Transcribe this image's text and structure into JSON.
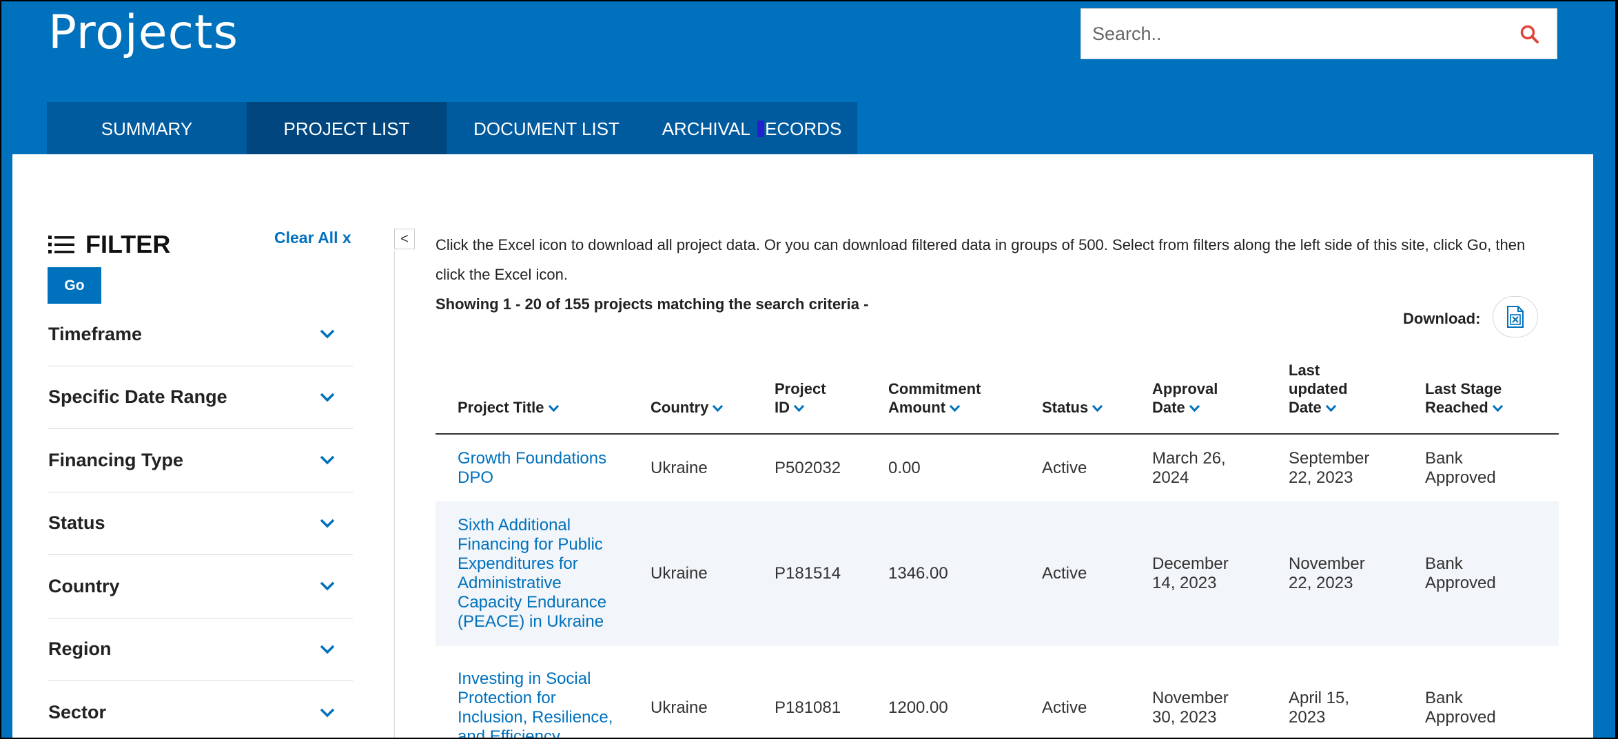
{
  "header": {
    "title": "Projects",
    "search_placeholder": "Search..",
    "search_icon": "search-icon",
    "accent_color": "#0071bc",
    "search_icon_color": "#e0453a"
  },
  "tabs": [
    {
      "label": "SUMMARY",
      "active": false
    },
    {
      "label": "PROJECT LIST",
      "active": true
    },
    {
      "label": "DOCUMENT LIST",
      "active": false
    },
    {
      "label_pre": "ARCHIVAL ",
      "label_post": "ECORDS",
      "active": false
    }
  ],
  "filter": {
    "title": "FILTER",
    "icon": "list-icon",
    "clear_all": "Clear All x",
    "go_label": "Go",
    "items": [
      "Timeframe",
      "Specific Date Range",
      "Financing Type",
      "Status",
      "Country",
      "Region",
      "Sector"
    ]
  },
  "collapse_label": "<",
  "main": {
    "info": "Click the Excel icon to download all project data. Or you can download filtered data in groups of 500. Select from filters along the left side of this site, click Go, then click the Excel icon.",
    "showing": "Showing 1 - 20 of 155 projects matching the search criteria -",
    "download_label": "Download:",
    "download_icon": "excel-icon"
  },
  "table": {
    "columns": [
      {
        "lines": [
          "Project Title"
        ]
      },
      {
        "lines": [
          "Country"
        ]
      },
      {
        "lines": [
          "Project",
          "ID"
        ]
      },
      {
        "lines": [
          "Commitment",
          "Amount"
        ]
      },
      {
        "lines": [
          "Status"
        ]
      },
      {
        "lines": [
          "Approval",
          "Date"
        ]
      },
      {
        "lines": [
          "Last",
          "updated",
          "Date"
        ]
      },
      {
        "lines": [
          "Last Stage",
          "Reached"
        ]
      }
    ],
    "rows": [
      {
        "title": [
          "Growth Foundations",
          "DPO"
        ],
        "country": "Ukraine",
        "id": "P502032",
        "amount": "0.00",
        "status": "Active",
        "approval": [
          "March 26,",
          "2024"
        ],
        "updated": [
          "September",
          "22, 2023"
        ],
        "stage": [
          "Bank",
          "Approved"
        ]
      },
      {
        "title": [
          "Sixth Additional",
          "Financing for Public",
          "Expenditures for",
          "Administrative",
          "Capacity Endurance",
          "(PEACE) in Ukraine"
        ],
        "country": "Ukraine",
        "id": "P181514",
        "amount": "1346.00",
        "status": "Active",
        "approval": [
          "December",
          "14, 2023"
        ],
        "updated": [
          "November",
          "22, 2023"
        ],
        "stage": [
          "Bank",
          "Approved"
        ]
      },
      {
        "title": [
          "Investing in Social",
          "Protection for",
          "Inclusion, Resilience,",
          "and Efficiency"
        ],
        "country": "Ukraine",
        "id": "P181081",
        "amount": "1200.00",
        "status": "Active",
        "approval": [
          "November",
          "30, 2023"
        ],
        "updated": [
          "April 15,",
          "2023"
        ],
        "stage": [
          "Bank",
          "Approved"
        ]
      }
    ]
  }
}
